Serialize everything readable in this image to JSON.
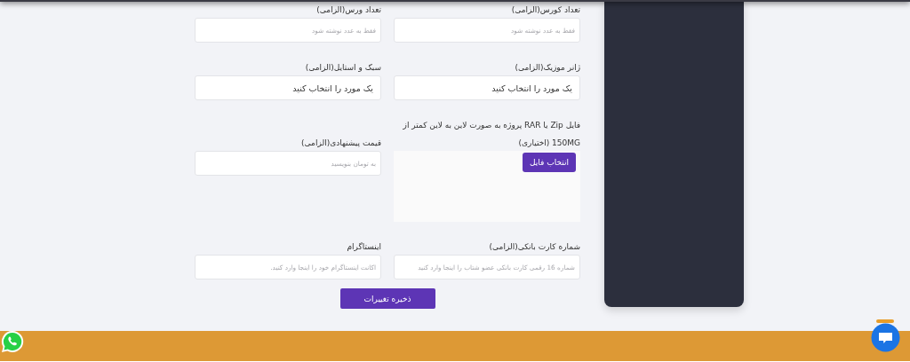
{
  "form": {
    "fields": [
      {
        "kind": "input",
        "label": "تعداد کورس(الزامی)",
        "placeholder": "فقط به عدد نوشته شود"
      },
      {
        "kind": "input",
        "label": "تعداد ورس(الزامی)",
        "placeholder": "فقط به عدد نوشته شود"
      },
      {
        "kind": "select",
        "label": "ژانر موزیک(الزامی)",
        "value": "یک مورد را انتخاب کنید"
      },
      {
        "kind": "select",
        "label": "سبک و استایل(الزامی)",
        "value": "یک مورد را انتخاب کنید"
      },
      {
        "kind": "file",
        "label": "فایل Zip یا RAR پروژه به صورت لاین به لاین کمتر از 150MG (اختیاری)",
        "button": "انتخاب فایل"
      },
      {
        "kind": "input",
        "label": "قیمت پیشنهادی(الزامی)",
        "placeholder": "به تومان بنویسید"
      },
      {
        "kind": "input",
        "label": "شماره کارت بانکی(الزامی)",
        "placeholder": "شماره 16 رقمی کارت بانکی عضو شتاب را اینجا وارد کنید"
      },
      {
        "kind": "input",
        "label": "اینستاگرام",
        "placeholder": "اکانت اینستاگرام خود را اینجا وارد کنید."
      }
    ],
    "save_button": "ذخیره تغییرات"
  }
}
